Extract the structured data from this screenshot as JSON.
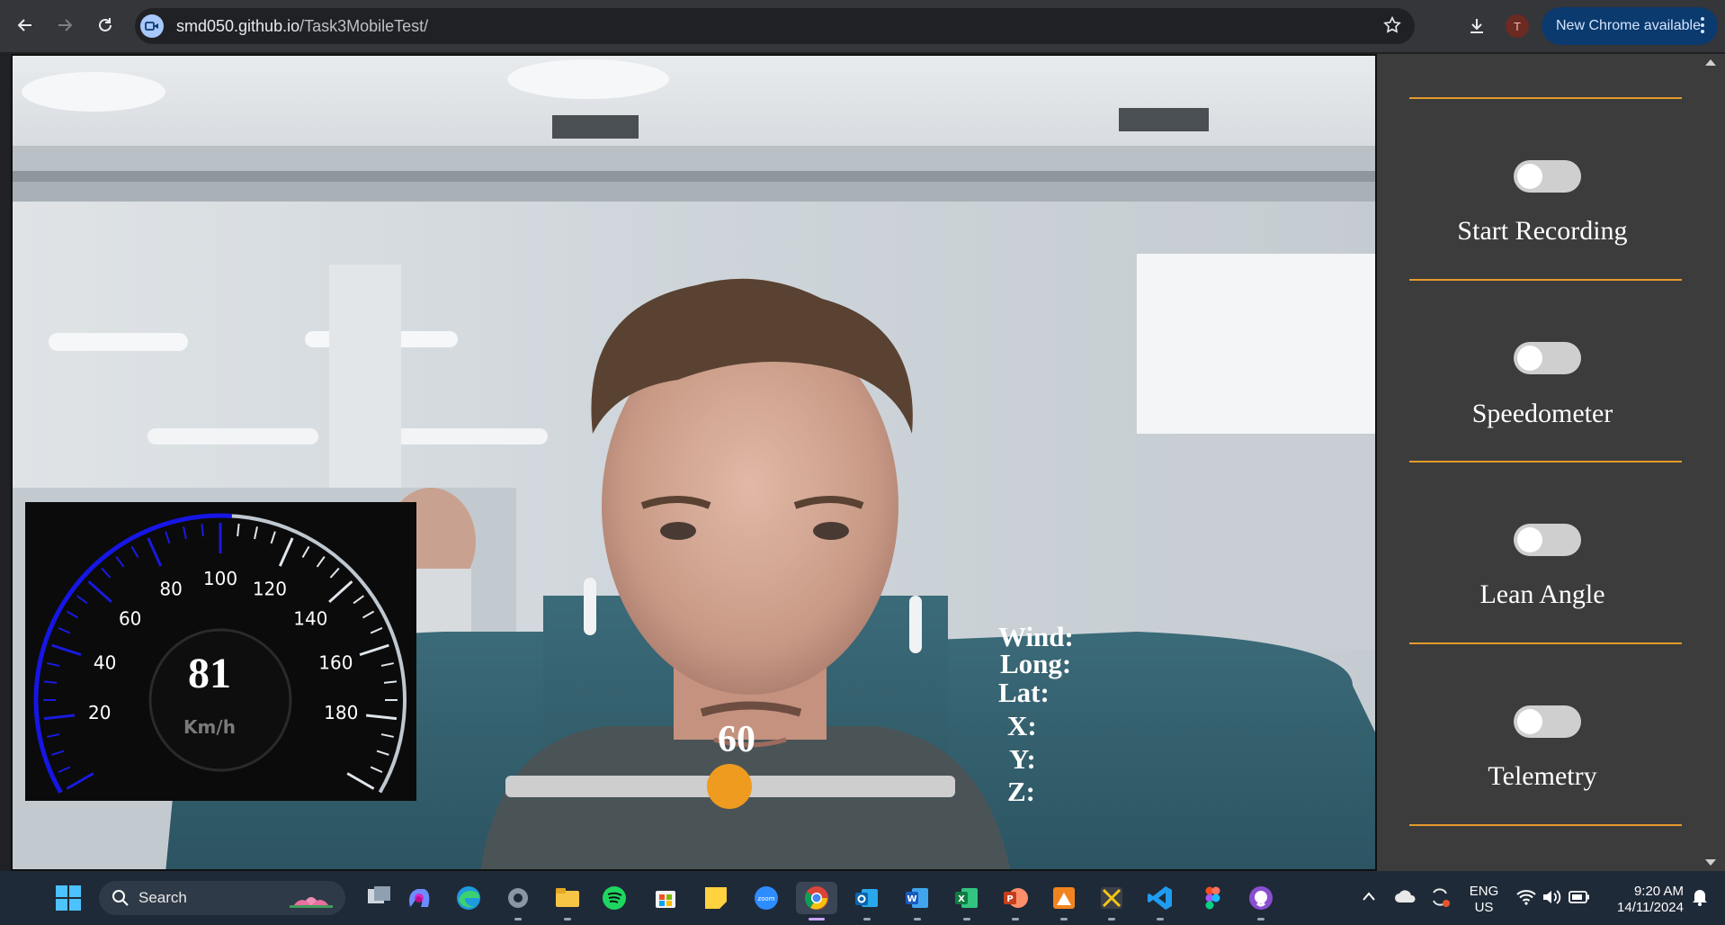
{
  "browser": {
    "url_host": "smd050.github.io",
    "url_path": "/Task3MobileTest/",
    "profile_initial": "T",
    "update_label": "New Chrome available"
  },
  "speedometer": {
    "speed": "81",
    "unit": "Km/h",
    "ticks": [
      "20",
      "40",
      "60",
      "80",
      "100",
      "120",
      "140",
      "160",
      "180"
    ]
  },
  "slider": {
    "value": "60",
    "level_percent": 60
  },
  "telemetry": {
    "wind": "Wind:",
    "long": "Long:",
    "lat": "Lat:",
    "x": "X:",
    "y": "Y:",
    "z": "Z:"
  },
  "panel": {
    "toggles": [
      {
        "label": "Start Recording",
        "on": false
      },
      {
        "label": "Speedometer",
        "on": false
      },
      {
        "label": "Lean Angle",
        "on": false
      },
      {
        "label": "Telemetry",
        "on": false
      }
    ]
  },
  "taskbar": {
    "search_label": "Search",
    "lang_line1": "ENG",
    "lang_line2": "US",
    "time": "9:20 AM",
    "date": "14/11/2024",
    "apps": [
      "start-icon",
      "task-view-icon",
      "copilot-icon",
      "edge-icon",
      "settings-icon",
      "file-explorer-icon",
      "spotify-icon",
      "store-icon",
      "sticky-notes-icon",
      "zoom-icon",
      "chrome-icon",
      "outlook-icon",
      "word-icon",
      "excel-icon",
      "powerpoint-icon",
      "app-orange-icon",
      "app-snip-icon",
      "vscode-icon",
      "figma-icon",
      "github-icon"
    ]
  }
}
